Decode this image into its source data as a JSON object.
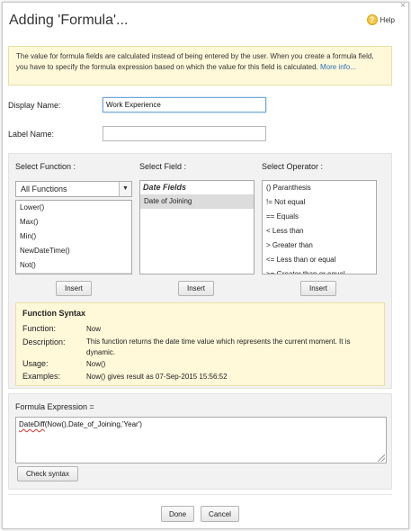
{
  "dialog": {
    "title": "Adding 'Formula'...",
    "close_glyph": "×",
    "help_label": "Help",
    "help_glyph": "?"
  },
  "info": {
    "text": "The value for formula fields are calculated instead of being entered by the user. When you create a formula field, you have to specify the formula expression based on which the value for this field is calculated.",
    "more_link": "More info..."
  },
  "display_name": {
    "label": "Display Name:",
    "value": "Work Experience"
  },
  "label_name": {
    "label": "Label Name:",
    "value": ""
  },
  "select_function": {
    "title": "Select Function :",
    "dropdown_value": "All Functions",
    "dropdown_arrow": "▼",
    "items": [
      "Lower()",
      "Max()",
      "Min()",
      "NewDateTime()",
      "Not()",
      ""
    ],
    "insert_label": "Insert"
  },
  "select_field": {
    "title": "Select Field :",
    "group": "Date Fields",
    "items": [
      "Date of Joining"
    ],
    "insert_label": "Insert"
  },
  "select_operator": {
    "title": "Select Operator :",
    "items": [
      "() Paranthesis",
      "!= Not equal",
      "== Equals",
      "< Less than",
      "> Greater than",
      "<= Less than or equal",
      ">= Greater than or equal"
    ],
    "insert_label": "Insert"
  },
  "function_syntax": {
    "title": "Function Syntax",
    "function_label": "Function:",
    "function_value": "Now",
    "description_label": "Description:",
    "description_value": "This function returns the date time value which represents the current moment. It is dynamic.",
    "usage_label": "Usage:",
    "usage_value": "Now()",
    "examples_label": "Examples:",
    "examples_value": "Now() gives result as 07-Sep-2015 15:56:52"
  },
  "formula": {
    "label": "Formula Expression =",
    "expression_start": "DateDiff",
    "expression_rest": "(Now(),Date_of_Joining,'Year')",
    "check_label": "Check syntax"
  },
  "footer": {
    "done_label": "Done",
    "cancel_label": "Cancel"
  }
}
